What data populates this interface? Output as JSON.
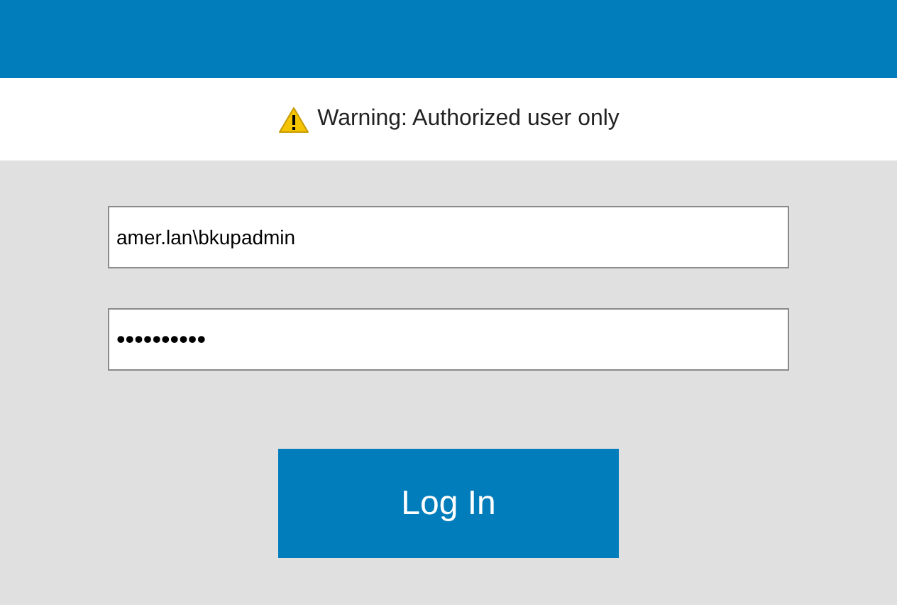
{
  "warning": {
    "text": "Warning: Authorized user only"
  },
  "username": {
    "value": "amer.lan\\bkupadmin"
  },
  "password": {
    "value": "••••••••••"
  },
  "login_button": {
    "label": "Log In"
  }
}
